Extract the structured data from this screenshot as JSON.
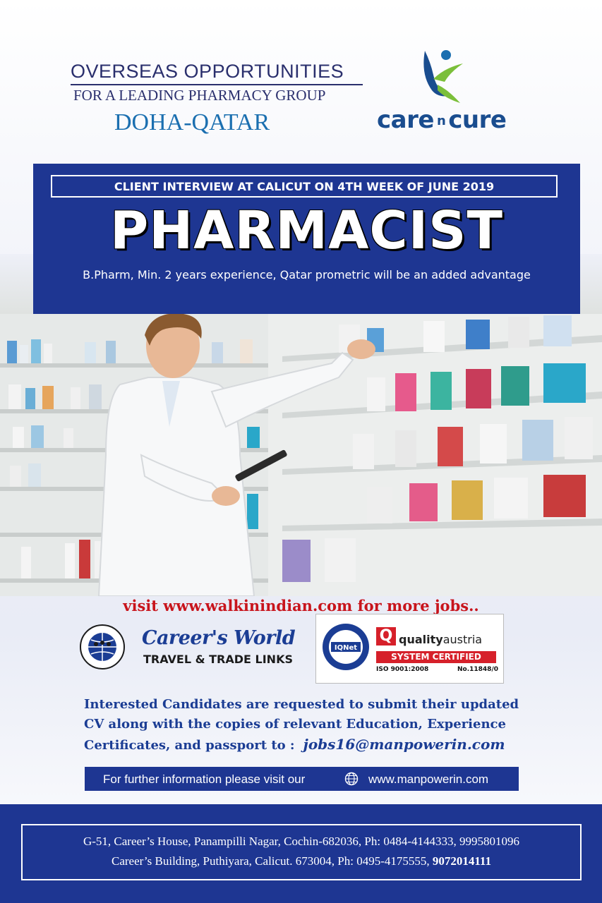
{
  "header": {
    "line1": "OVERSEAS OPPORTUNITIES",
    "line2": "FOR A LEADING PHARMACY GROUP",
    "location": "DOHA-QATAR"
  },
  "logo": {
    "word1": "care",
    "word2": "n",
    "word3": "cure"
  },
  "panel": {
    "interview": "CLIENT INTERVIEW AT CALICUT ON 4TH WEEK OF JUNE 2019",
    "title": "PHARMACIST",
    "requirements": "B.Pharm,  Min. 2 years experience, Qatar prometric will be an added advantage"
  },
  "visit_line": "visit www.walkinindian.com for more jobs..",
  "careers_world": {
    "name": "Career's World",
    "tagline": "TRAVEL & TRADE LINKS"
  },
  "certification": {
    "iqnet": "IQNet",
    "q": "Q",
    "quality_bold": "quality",
    "quality_rest": "austria",
    "system": "SYSTEM CERTIFIED",
    "iso": "ISO 9001:2008",
    "number": "No.11848/0"
  },
  "interest": {
    "line1": "Interested Candidates are requested to submit their updated",
    "line2": "CV along with the copies of  relevant  Education, Experience",
    "line3": "Certificates, and passport  to :",
    "email": "jobs16@manpowerin.com"
  },
  "info_bar": {
    "text": "For further information please visit our",
    "url": "www.manpowerin.com"
  },
  "footer": {
    "address1": "G-51, Career’s House, Panampilli Nagar, Cochin-682036, Ph: 0484-4144333, 9995801096",
    "address2": "Career’s Building, Puthiyara, Calicut. 673004, Ph: 0495-4175555,",
    "phone_bold": "9072014111"
  },
  "colors": {
    "brand_blue": "#1e3692",
    "heading_blue": "#2a2f6d",
    "accent_red": "#c8141c",
    "logo_green": "#7bbf3a"
  }
}
